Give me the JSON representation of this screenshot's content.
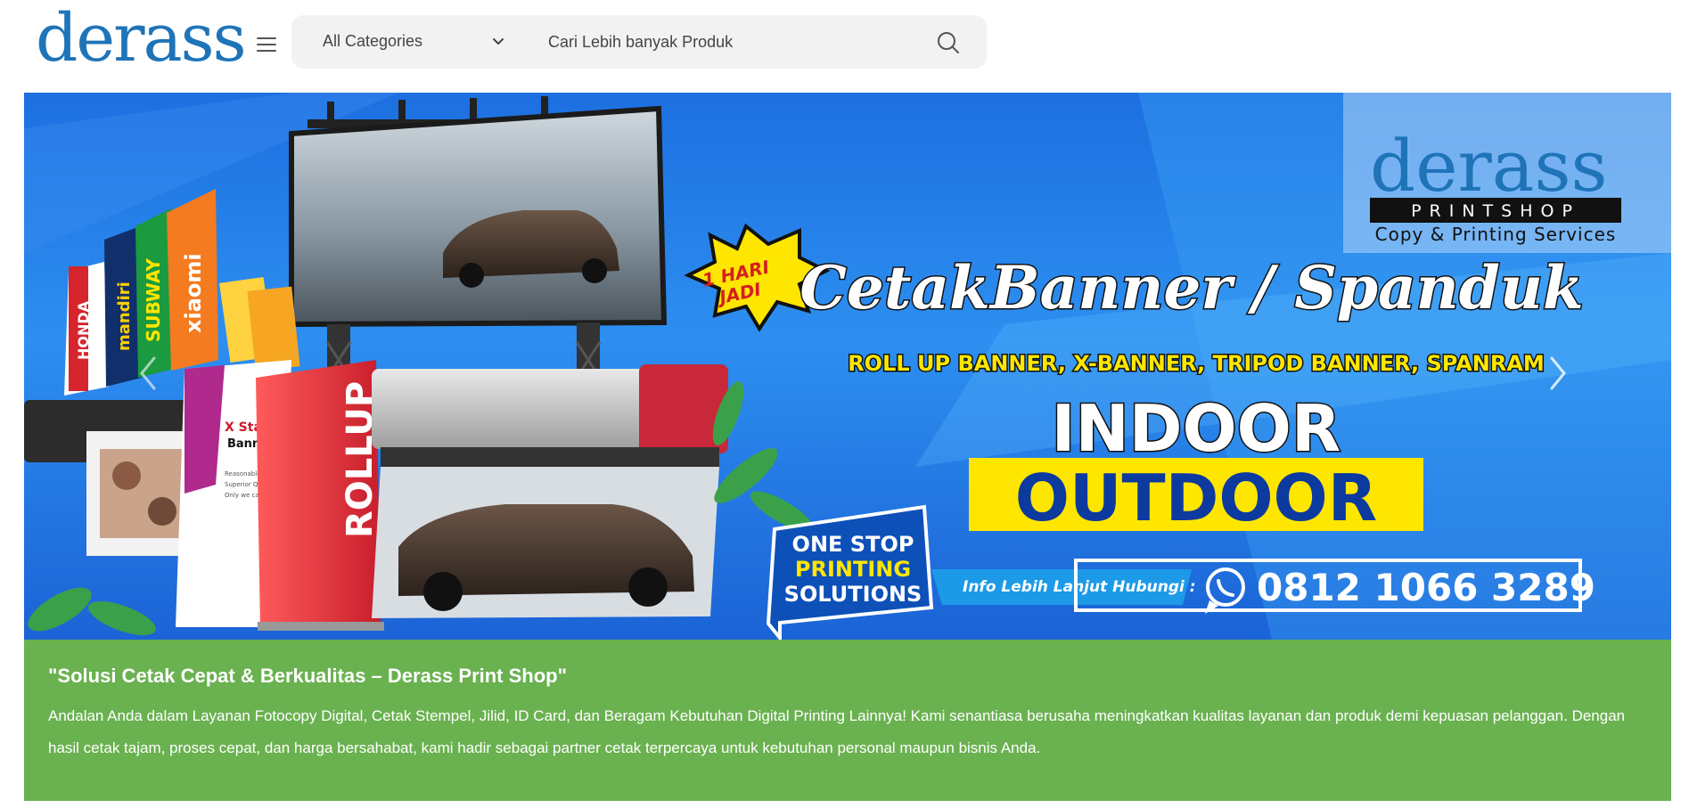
{
  "header": {
    "logo": "derass",
    "search": {
      "category": "All Categories",
      "placeholder": "Cari Lebih banyak Produk"
    }
  },
  "banner": {
    "brand": "derass",
    "brand_sub": "PRINTSHOP",
    "brand_tagline": "Copy & Printing Services",
    "headline": "CetakBanner / Spanduk",
    "subline": "ROLL UP BANNER, X-BANNER, TRIPOD BANNER, SPANRAM",
    "indoor": "INDOOR",
    "outdoor": "OUTDOOR",
    "badge_line1": "1 HARI",
    "badge_line2": "JADI",
    "onestop_line1": "ONE STOP",
    "onestop_line2": "PRINTING",
    "onestop_line3": "SOLUTIONS",
    "contact_label": "Info Lebih Lanjut Hubungi :",
    "phone": "0812 1066 3289",
    "flag_labels": [
      "HONDA",
      "mandiri",
      "SUBWAY",
      "xiaomi"
    ],
    "rollup_label": "ROLLUP",
    "xstand_title": "X Stand",
    "xstand_sub": "Banner",
    "xstand_lines": [
      "Reasonable Price.",
      "Superior Quality.",
      "Only we can."
    ],
    "colors": {
      "brand_blue": "#1f74b8",
      "outdoor_bg": "#ffe600",
      "outdoor_text": "#0d3a9e",
      "subline": "#ffe600"
    }
  },
  "info": {
    "title": "\"Solusi Cetak Cepat & Berkualitas – Derass Print Shop\"",
    "body": "Andalan Anda dalam Layanan Fotocopy Digital, Cetak Stempel, Jilid, ID Card, dan Beragam Kebutuhan Digital Printing Lainnya! Kami senantiasa berusaha meningkatkan kualitas layanan dan produk demi kepuasan pelanggan. Dengan hasil cetak tajam, proses cepat, dan harga bersahabat, kami hadir sebagai partner cetak terpercaya untuk kebutuhan personal maupun bisnis Anda.",
    "bg_color": "#6ab150"
  },
  "icons": {
    "menu": "hamburger-icon",
    "dropdown": "chevron-down-icon",
    "search": "search-icon",
    "prev": "chevron-left-icon",
    "next": "chevron-right-icon",
    "whatsapp": "whatsapp-icon"
  }
}
